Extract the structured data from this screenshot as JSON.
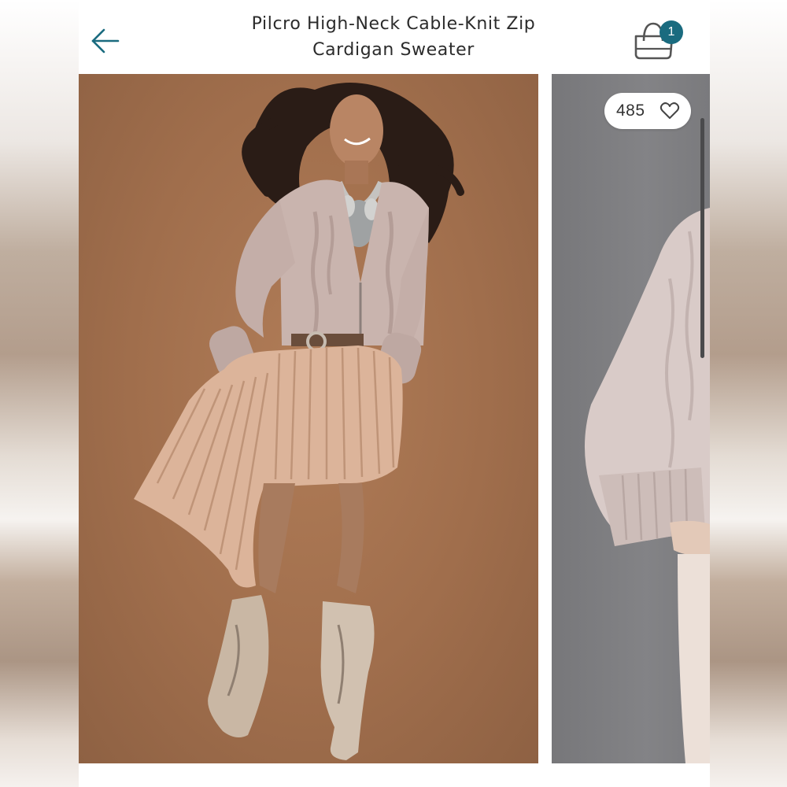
{
  "header": {
    "back_icon": "arrow-left-icon",
    "title": "Pilcro High-Neck Cable-Knit Zip Cardigan Sweater",
    "bag_icon": "shopping-bag-icon",
    "bag_count": "1"
  },
  "gallery": {
    "images": [
      {
        "alt": "Model wearing pink cable-knit cardigan with metallic pleated skirt and silver boots"
      },
      {
        "alt": "Close-up of cardigan sleeve"
      }
    ],
    "favorites": {
      "count": "485",
      "icon": "heart-outline-icon"
    }
  },
  "colors": {
    "accent": "#1a6b7f",
    "photo1_bg": "#a06e4c",
    "photo2_bg": "#7f7f82",
    "sweater": "#c9b4ae",
    "skirt": "#dcb49a",
    "boots": "#c9b7a4"
  }
}
